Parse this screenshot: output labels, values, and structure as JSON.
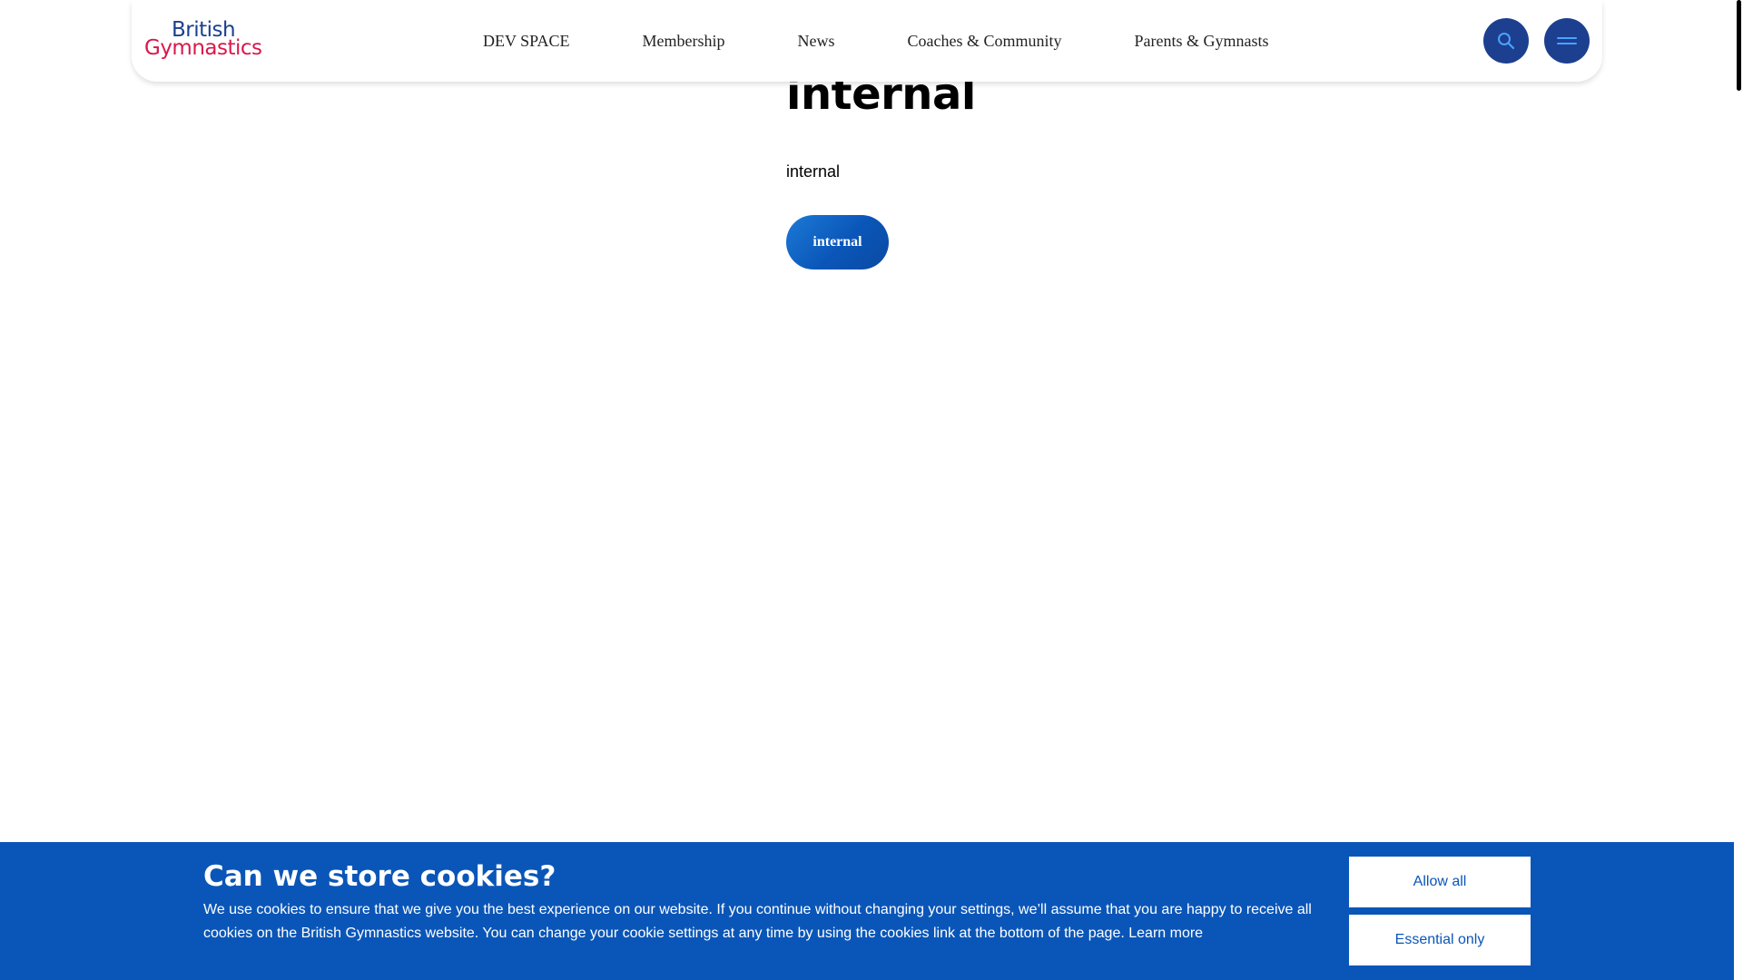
{
  "header": {
    "logo": {
      "line1": "British",
      "line2": "Gymnastics",
      "colors": {
        "line1": "#1d3f8f",
        "line2": "#d7194d"
      }
    },
    "nav": [
      {
        "label": "DEV SPACE"
      },
      {
        "label": "Membership"
      },
      {
        "label": "News"
      },
      {
        "label": "Coaches & Community"
      },
      {
        "label": "Parents & Gymnasts"
      }
    ],
    "search_icon": "search-icon",
    "menu_icon": "hamburger-menu-icon",
    "accent_color": "#1d3f8f"
  },
  "main": {
    "title": "internal",
    "text": "internal",
    "button_label": "internal",
    "button_color": "#0a56b8"
  },
  "cookie_banner": {
    "title": "Can we store cookies?",
    "text": "We use cookies to ensure that we give you the best experience on our website. If you continue without changing your settings, we’ll assume that you are happy to receive all cookies on the British Gymnastics website. You can change your cookie settings at any time by using the cookies link at the bottom of the page.",
    "learn_more": "Learn more",
    "allow_all": "Allow all",
    "essential_only": "Essential only",
    "background_color": "#0a56b8"
  }
}
